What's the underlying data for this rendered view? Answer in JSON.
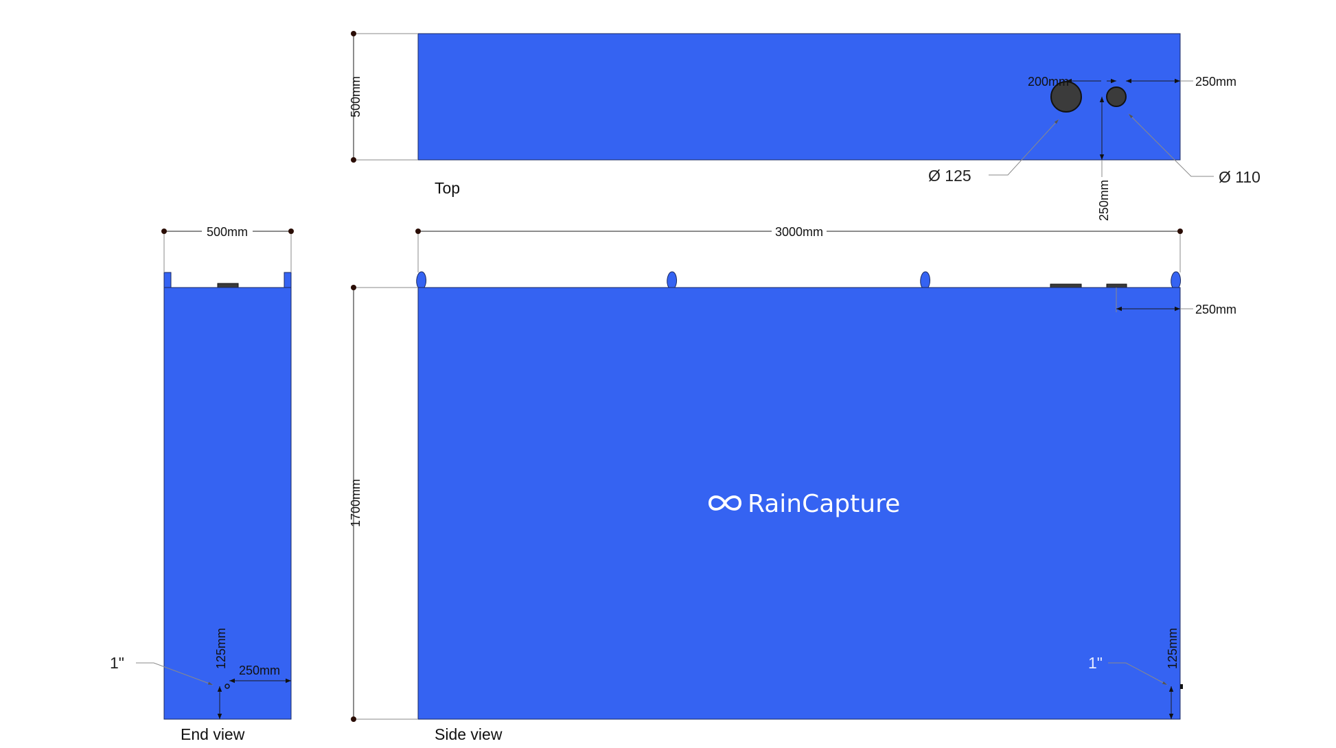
{
  "views": {
    "top": "Top",
    "end": "End view",
    "side": "Side view"
  },
  "dimensions": {
    "top_height": "500mm",
    "top_offset_200": "200mm",
    "top_offset_250_right": "250mm",
    "top_offset_250_vertical": "250mm",
    "dia_large": "Ø 125",
    "dia_small": "Ø 110",
    "end_width": "500mm",
    "end_outlet_height": "125mm",
    "end_outlet_offset": "250mm",
    "end_fitting": "1\"",
    "side_length": "3000mm",
    "side_height": "1700mm",
    "side_offset_250": "250mm",
    "side_outlet_height": "125mm",
    "side_fitting": "1\""
  },
  "brand": {
    "name": "RainCapture",
    "logo_icon": "infinity-icon",
    "tank_color": "#3563f2"
  }
}
